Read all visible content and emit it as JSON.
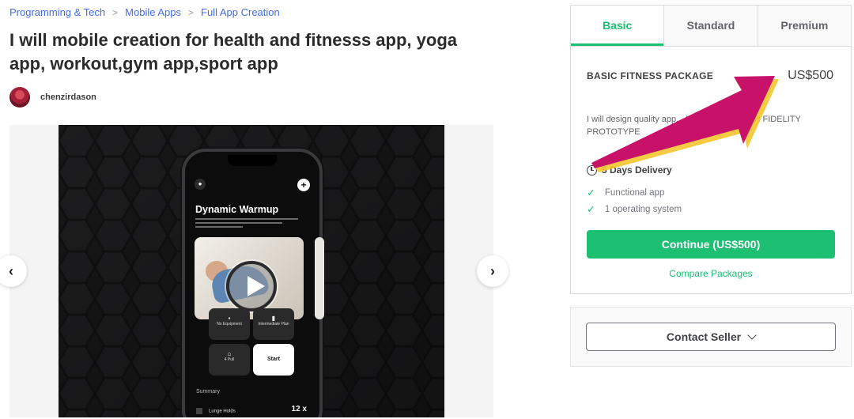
{
  "breadcrumb": {
    "items": [
      "Programming & Tech",
      "Mobile Apps",
      "Full App Creation"
    ],
    "separator": ">"
  },
  "gig": {
    "title": "I will mobile creation for health and fitnesss app, yoga app, workout,gym app,sport app"
  },
  "seller": {
    "name": "chenzirdason"
  },
  "gallery": {
    "prev_icon": "chevron-left-icon",
    "next_icon": "chevron-right-icon",
    "phone": {
      "screen_title": "Dynamic Warmup",
      "tiles": [
        "No Equipment",
        "Intermediate Plan",
        "4 Pull",
        "Start"
      ],
      "summary_label": "Summary",
      "row_label": "Lunge Holds",
      "row_value": "12 x"
    }
  },
  "package": {
    "tabs": [
      "Basic",
      "Standard",
      "Premium"
    ],
    "active_tab": "Basic",
    "name": "BASIC FITNESS PACKAGE",
    "price": "US$500",
    "description": "I will design quality app... UX DESIGN, HIGH FIDELITY PROTOTYPE",
    "delivery": "5 Days Delivery",
    "features": [
      "Functional app",
      "1 operating system"
    ],
    "continue_label": "Continue (US$500)",
    "compare_label": "Compare Packages"
  },
  "contact": {
    "label": "Contact Seller"
  },
  "colors": {
    "brand_green": "#1dbf73",
    "link_blue": "#446ee7",
    "annotation_arrow": "#c8126a"
  }
}
